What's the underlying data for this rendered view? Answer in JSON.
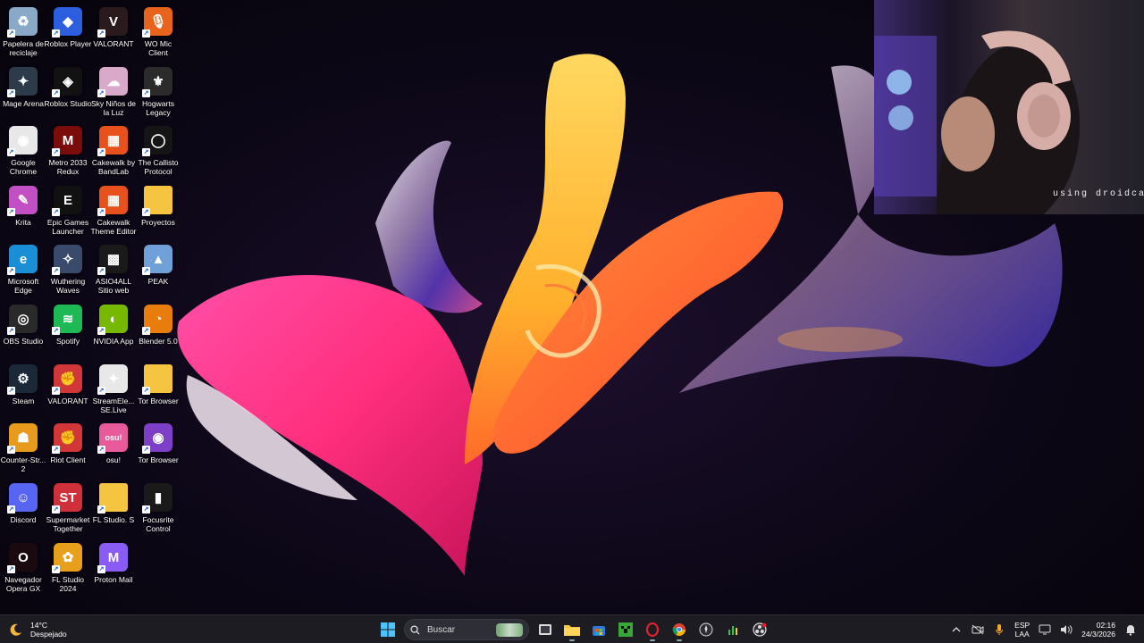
{
  "desktop": {
    "icons": [
      {
        "label": "Papelera de reciclaje",
        "icon": "recycle-bin-icon",
        "color": "#8aa8c8",
        "glyph": "♻"
      },
      {
        "label": "Roblox Player",
        "icon": "roblox-icon",
        "color": "#2b5fe0",
        "glyph": "◆"
      },
      {
        "label": "VALORANT",
        "icon": "valorant-icon",
        "color": "#2a1a1e",
        "glyph": "V"
      },
      {
        "label": "WO Mic Client",
        "icon": "microphone-icon",
        "color": "#e8641c",
        "glyph": "🎙"
      },
      {
        "label": "Mage Arena",
        "icon": "mage-arena-icon",
        "color": "#2c3a4a",
        "glyph": "✦"
      },
      {
        "label": "Roblox Studio",
        "icon": "roblox-studio-icon",
        "color": "#121212",
        "glyph": "◈"
      },
      {
        "label": "Sky Niños de la Luz",
        "icon": "sky-icon",
        "color": "#d9a9c9",
        "glyph": "☁"
      },
      {
        "label": "Hogwarts Legacy",
        "icon": "hogwarts-icon",
        "color": "#2b2b2b",
        "glyph": "⚜"
      },
      {
        "label": "Google Chrome",
        "icon": "chrome-icon",
        "color": "#e8e8e8",
        "glyph": "◉"
      },
      {
        "label": "Metro 2033 Redux",
        "icon": "metro-icon",
        "color": "#7a0c0c",
        "glyph": "M"
      },
      {
        "label": "Cakewalk by BandLab",
        "icon": "cakewalk-icon",
        "color": "#e8501c",
        "glyph": "▦"
      },
      {
        "label": "The Callisto Protocol",
        "icon": "callisto-icon",
        "color": "#151515",
        "glyph": "◯"
      },
      {
        "label": "Krita",
        "icon": "krita-icon",
        "color": "#c24fc4",
        "glyph": "✎"
      },
      {
        "label": "Epic Games Launcher",
        "icon": "epic-games-icon",
        "color": "#111111",
        "glyph": "E"
      },
      {
        "label": "Cakewalk Theme Editor",
        "icon": "cakewalk-theme-icon",
        "color": "#e8501c",
        "glyph": "▦"
      },
      {
        "label": "Proyectos",
        "icon": "folder-icon",
        "color": "#f5c542",
        "glyph": ""
      },
      {
        "label": "Microsoft Edge",
        "icon": "edge-icon",
        "color": "#1a8fd6",
        "glyph": "e"
      },
      {
        "label": "Wuthering Waves",
        "icon": "wuthering-waves-icon",
        "color": "#3a4a6a",
        "glyph": "✧"
      },
      {
        "label": "ASIO4ALL Sitio web",
        "icon": "asio4all-icon",
        "color": "#1a1a1a",
        "glyph": "▩"
      },
      {
        "label": "PEAK",
        "icon": "peak-icon",
        "color": "#6fa0d8",
        "glyph": "▲"
      },
      {
        "label": "OBS Studio",
        "icon": "obs-icon",
        "color": "#2a2a2a",
        "glyph": "◎"
      },
      {
        "label": "Spotify",
        "icon": "spotify-icon",
        "color": "#1db954",
        "glyph": "≋"
      },
      {
        "label": "NVIDIA App",
        "icon": "nvidia-icon",
        "color": "#76b900",
        "glyph": "◐"
      },
      {
        "label": "Blender 5.0",
        "icon": "blender-icon",
        "color": "#e87d0d",
        "glyph": "◔"
      },
      {
        "label": "Steam",
        "icon": "steam-icon",
        "color": "#1b2838",
        "glyph": "⚙"
      },
      {
        "label": "VALORANT",
        "icon": "riot-valorant-icon",
        "color": "#d13639",
        "glyph": "✊"
      },
      {
        "label": "StreamEle... SE.Live",
        "icon": "streamelements-icon",
        "color": "#e8e8e8",
        "glyph": "✦"
      },
      {
        "label": "Tor Browser",
        "icon": "tor-folder-icon",
        "color": "#f5c542",
        "glyph": ""
      },
      {
        "label": "Counter-Str... 2",
        "icon": "counter-strike-icon",
        "color": "#e89a1c",
        "glyph": "☗"
      },
      {
        "label": "Riot Client",
        "icon": "riot-client-icon",
        "color": "#d13639",
        "glyph": "✊"
      },
      {
        "label": "osu!",
        "icon": "osu-icon",
        "color": "#e85a9a",
        "glyph": "osu!"
      },
      {
        "label": "Tor Browser",
        "icon": "tor-browser-icon",
        "color": "#7d3fc8",
        "glyph": "◉"
      },
      {
        "label": "Discord",
        "icon": "discord-icon",
        "color": "#5865f2",
        "glyph": "☺"
      },
      {
        "label": "Supermarket Together",
        "icon": "supermarket-icon",
        "color": "#d0303a",
        "glyph": "ST"
      },
      {
        "label": "FL Studio. S",
        "icon": "fl-folder-icon",
        "color": "#f5c542",
        "glyph": ""
      },
      {
        "label": "Focusrite Control",
        "icon": "focusrite-icon",
        "color": "#1a1a1a",
        "glyph": "▮"
      },
      {
        "label": "Navegador Opera GX",
        "icon": "opera-gx-icon",
        "color": "#1a0a10",
        "glyph": "O"
      },
      {
        "label": "FL Studio 2024",
        "icon": "fl-studio-icon",
        "color": "#e8a01c",
        "glyph": "✿"
      },
      {
        "label": "Proton Mail",
        "icon": "proton-mail-icon",
        "color": "#8a5cf6",
        "glyph": "M"
      }
    ]
  },
  "webcam": {
    "caption": "using droidcam"
  },
  "taskbar": {
    "weather": {
      "temp": "14°C",
      "condition": "Despejado"
    },
    "search": {
      "placeholder": "Buscar"
    },
    "tray": {
      "lang_top": "ESP",
      "lang_bottom": "LAA",
      "time": "02:16",
      "date": "24/3/2026"
    },
    "colors": {
      "start": "#4cc2ff",
      "explorer": "#f5c542",
      "minecraft": "#3aa63a",
      "opera": "#e0202a"
    }
  }
}
